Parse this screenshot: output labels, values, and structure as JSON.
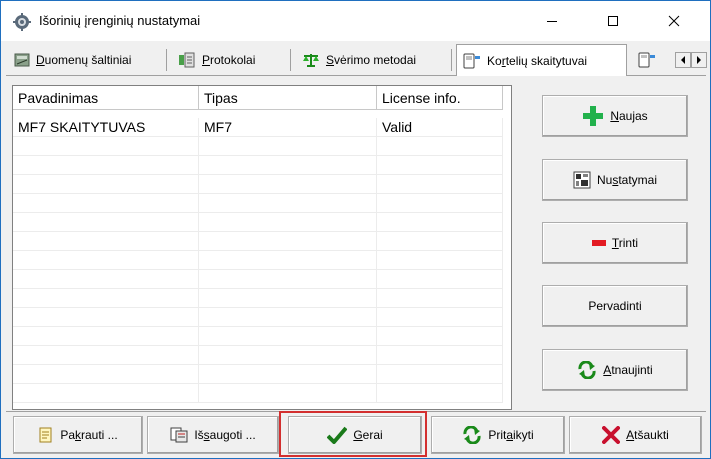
{
  "window": {
    "title": "Išorinių įrenginių nustatymai",
    "border_color": "#1f6fbf"
  },
  "tabs": [
    {
      "label_u": "D",
      "label_rest": "uomenų šaltiniai",
      "icon": "database-icon"
    },
    {
      "label_u": "P",
      "label_rest": "rotokolai",
      "icon": "protocol-icon"
    },
    {
      "label_u": "S",
      "label_rest": "vėrimo metodai",
      "icon": "scale-icon"
    },
    {
      "label_pre": "Ko",
      "label_u": "r",
      "label_rest": "telių skaitytuvai",
      "icon": "card-reader-icon",
      "active": true
    },
    {
      "label": "",
      "icon": "device-icon"
    }
  ],
  "table": {
    "columns": [
      "Pavadinimas",
      "Tipas",
      "License info."
    ],
    "rows": [
      [
        "MF7 SKAITYTUVAS",
        "MF7",
        "Valid"
      ]
    ]
  },
  "side_buttons": {
    "new_u": "N",
    "new_rest": "aujas",
    "settings_pre": "Nu",
    "settings_u": "s",
    "settings_rest": "tatymai",
    "delete_u": "T",
    "delete_pre": "",
    "delete_rest": "rinti",
    "rename": "Pervadinti",
    "refresh_u": "A",
    "refresh_rest": "tnaujinti"
  },
  "bottom_buttons": {
    "load_pre": "Pa",
    "load_u": "k",
    "load_rest": "rauti ...",
    "save_pre": "Iš",
    "save_u": "s",
    "save_rest": "augoti ...",
    "ok_u": "G",
    "ok_rest": "erai",
    "apply_pre": "Prit",
    "apply_u": "a",
    "apply_rest": "ikyti",
    "cancel_u": "A",
    "cancel_rest": "tšaukti"
  },
  "colors": {
    "highlight": "#d32f2f",
    "plus": "#22b14c",
    "minus": "#e31b23",
    "check": "#1a7a1a",
    "cross": "#c8102e"
  }
}
